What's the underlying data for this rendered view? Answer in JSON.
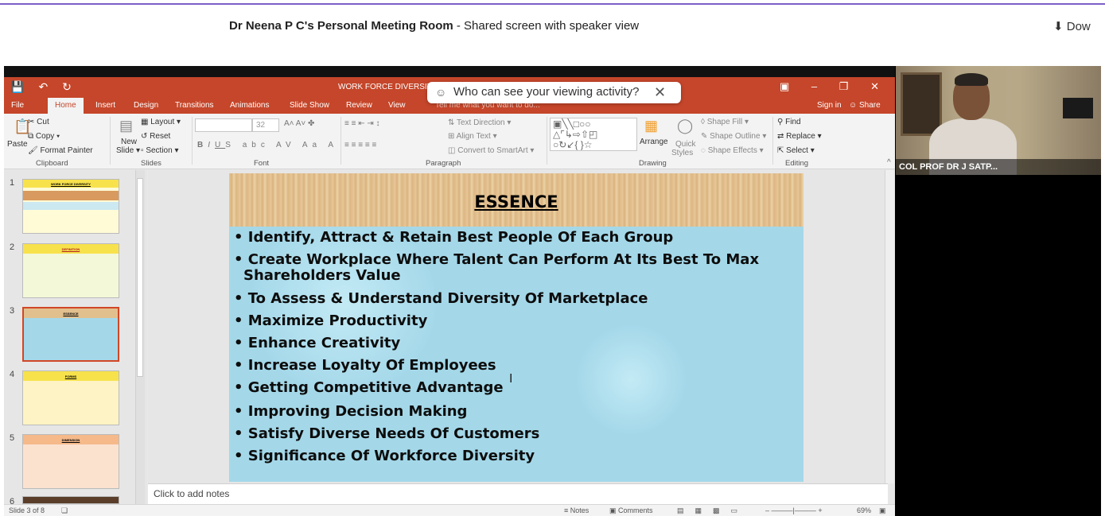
{
  "page": {
    "host_name": "Dr Neena P C's Personal Meeting Room",
    "subtitle": " - Shared screen with speaker view",
    "download_label": "Dow"
  },
  "popup": {
    "text": "Who can see your viewing activity?",
    "close_icon": "close-icon"
  },
  "powerpoint": {
    "doc_title": "WORK FORCE DIVERSITY -",
    "tabs": [
      "File",
      "Home",
      "Insert",
      "Design",
      "Transitions",
      "Animations",
      "Slide Show",
      "Review",
      "View"
    ],
    "tell_me": "Tell me what you want to do...",
    "sign_in": "Sign in",
    "share": "Share",
    "ribbon": {
      "clipboard": {
        "cut": "Cut",
        "copy": "Copy",
        "format_painter": "Format Painter",
        "paste": "Paste",
        "group": "Clipboard"
      },
      "slides": {
        "new_slide": "New",
        "slide": "Slide",
        "layout": "Layout",
        "reset": "Reset",
        "section": "Section",
        "group": "Slides"
      },
      "font": {
        "size": "32",
        "group": "Font"
      },
      "paragraph": {
        "text_direction": "Text Direction",
        "align_text": "Align Text",
        "convert": "Convert to SmartArt",
        "group": "Paragraph"
      },
      "drawing": {
        "arrange": "Arrange",
        "quick": "Quick",
        "styles": "Styles",
        "shape_fill": "Shape Fill",
        "shape_outline": "Shape Outline",
        "shape_effects": "Shape Effects",
        "group": "Drawing"
      },
      "editing": {
        "find": "Find",
        "replace": "Replace",
        "select": "Select",
        "group": "Editing"
      }
    },
    "thumbnails": [
      {
        "num": "1",
        "title": "WORK FORCE DIVERSITY"
      },
      {
        "num": "2",
        "title": "DEFINITION"
      },
      {
        "num": "3",
        "title": "ESSENCE"
      },
      {
        "num": "4",
        "title": "FORMS"
      },
      {
        "num": "5",
        "title": "DIMENSION"
      },
      {
        "num": "6",
        "title": ""
      }
    ],
    "slide": {
      "title": "ESSENCE",
      "bullets": [
        "• Identify, Attract & Retain Best People Of Each Group",
        "• Create Workplace Where Talent Can Perform At Its Best To Max",
        "Shareholders Value",
        "•  To Assess & Understand Diversity Of Marketplace",
        "•  Maximize Productivity",
        "•  Enhance Creativity",
        "•  Increase Loyalty Of Employees",
        "•  Getting Competitive Advantage",
        "• Improving Decision Making",
        "• Satisfy Diverse Needs Of Customers",
        "• Significance Of Workforce Diversity"
      ]
    },
    "notes_placeholder": "Click to add notes",
    "status": {
      "slide_of": "Slide 3 of 8",
      "notes": "Notes",
      "comments": "Comments",
      "zoom": "69%"
    }
  },
  "speaker": {
    "name": "COL PROF DR J SATP..."
  }
}
